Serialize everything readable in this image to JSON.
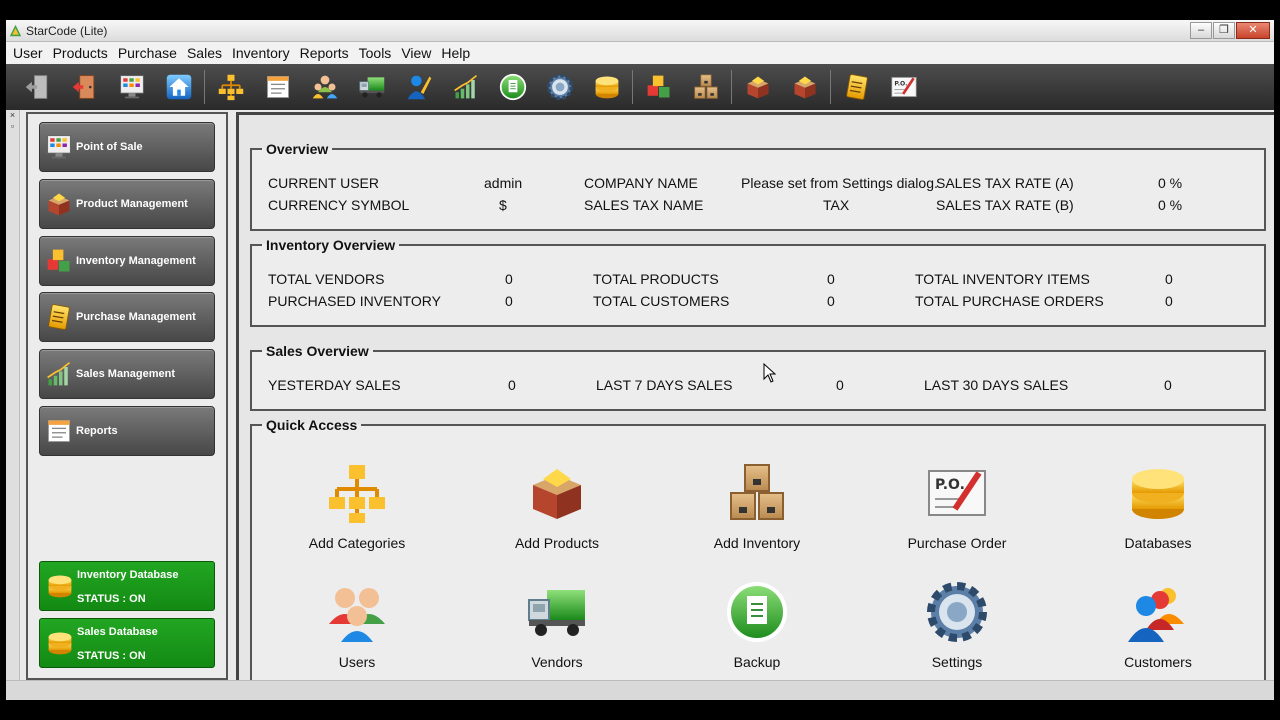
{
  "window": {
    "title": "StarCode (Lite)"
  },
  "menu": [
    "User",
    "Products",
    "Purchase",
    "Sales",
    "Inventory",
    "Reports",
    "Tools",
    "View",
    "Help"
  ],
  "toolbar": {
    "buttons": [
      "logout-icon",
      "exit-icon",
      "pos-icon",
      "home-icon",
      "categories-icon",
      "reports-icon",
      "users-icon",
      "vendors-icon",
      "customers-icon",
      "sales-icon",
      "backup-icon",
      "settings-icon",
      "databases-icon",
      "inventory-icon",
      "add-inventory-icon",
      "products-icon",
      "add-products-icon",
      "purchase-icon",
      "purchase-order-icon"
    ]
  },
  "gutter": {
    "close": "×",
    "pin": "▫"
  },
  "sidebar": {
    "nav": [
      {
        "label": "Point of Sale",
        "icon": "pos-icon"
      },
      {
        "label": "Product Management",
        "icon": "products-icon"
      },
      {
        "label": "Inventory Management",
        "icon": "inventory-icon"
      },
      {
        "label": "Purchase Management",
        "icon": "purchase-icon"
      },
      {
        "label": "Sales Management",
        "icon": "sales-icon"
      },
      {
        "label": "Reports",
        "icon": "reports-icon"
      }
    ],
    "databases": [
      {
        "name": "Inventory Database",
        "status": "STATUS : ON"
      },
      {
        "name": "Sales Database",
        "status": "STATUS : ON"
      }
    ]
  },
  "overview": {
    "title": "Overview",
    "current_user_label": "CURRENT USER",
    "current_user": "admin",
    "company_name_label": "COMPANY NAME",
    "company_name": "Please set from Settings dialog.",
    "tax_rate_a_label": "SALES TAX RATE (A)",
    "tax_rate_a": "0 %",
    "currency_label": "CURRENCY SYMBOL",
    "currency": "$",
    "tax_name_label": "SALES TAX NAME",
    "tax_name": "TAX",
    "tax_rate_b_label": "SALES TAX RATE (B)",
    "tax_rate_b": "0 %"
  },
  "inventory_overview": {
    "title": "Inventory Overview",
    "total_vendors_label": "TOTAL VENDORS",
    "total_vendors": "0",
    "total_products_label": "TOTAL PRODUCTS",
    "total_products": "0",
    "total_items_label": "TOTAL INVENTORY ITEMS",
    "total_items": "0",
    "purchased_label": "PURCHASED INVENTORY",
    "purchased": "0",
    "total_customers_label": "TOTAL CUSTOMERS",
    "total_customers": "0",
    "total_po_label": "TOTAL PURCHASE ORDERS",
    "total_po": "0"
  },
  "sales_overview": {
    "title": "Sales Overview",
    "yesterday_label": "YESTERDAY SALES",
    "yesterday": "0",
    "last7_label": "LAST 7 DAYS SALES",
    "last7": "0",
    "last30_label": "LAST 30 DAYS SALES",
    "last30": "0"
  },
  "quick_access": {
    "title": "Quick Access",
    "items": [
      {
        "label": "Add Categories",
        "icon": "categories-icon"
      },
      {
        "label": "Add Products",
        "icon": "add-products-icon"
      },
      {
        "label": "Add Inventory",
        "icon": "add-inventory-icon"
      },
      {
        "label": "Purchase Order",
        "icon": "purchase-order-icon"
      },
      {
        "label": "Databases",
        "icon": "databases-icon"
      },
      {
        "label": "Users",
        "icon": "users-icon"
      },
      {
        "label": "Vendors",
        "icon": "vendors-icon"
      },
      {
        "label": "Backup",
        "icon": "backup-icon"
      },
      {
        "label": "Settings",
        "icon": "settings-icon"
      },
      {
        "label": "Customers",
        "icon": "customers-icon"
      }
    ]
  },
  "colors": {
    "toolbar": "#3a3a3a",
    "nav_button": "#5e5e5e",
    "db_status": "#1b9b1b",
    "panel": "#ededed"
  }
}
